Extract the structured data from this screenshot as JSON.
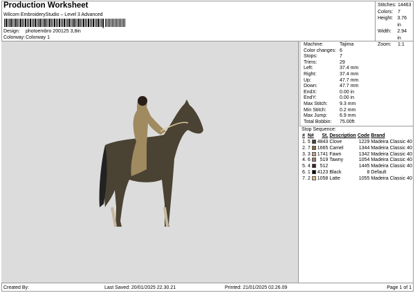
{
  "header": {
    "title": "Production Worksheet",
    "subtitle": "Wilcom EmbroideryStudio – Level 3 Advanced",
    "barcode_suffix": ",",
    "design_label": "Design:",
    "design_value": "photoembro 200125 3,8in",
    "colorway_label": "Colorway:",
    "colorway_value": "Colorway 1"
  },
  "stats": [
    {
      "k": "Stitches:",
      "v": "14463"
    },
    {
      "k": "Colors:",
      "v": "7"
    },
    {
      "k": "Height:",
      "v": "3.76 in"
    },
    {
      "k": "Width:",
      "v": "2.94 in"
    },
    {
      "k": "Zoom:",
      "v": "1:1"
    }
  ],
  "machine_info": [
    {
      "k": "Machine:",
      "v": "Tajima"
    },
    {
      "k": "Color changes:",
      "v": "6"
    },
    {
      "k": "Stops:",
      "v": "7"
    },
    {
      "k": "Trims:",
      "v": "29"
    },
    {
      "k": "Left:",
      "v": "37.4 mm"
    },
    {
      "k": "Right:",
      "v": "37.4 mm"
    },
    {
      "k": "Up:",
      "v": "47.7 mm"
    },
    {
      "k": "Down:",
      "v": "47.7 mm"
    },
    {
      "k": "EndX:",
      "v": "0.00 in"
    },
    {
      "k": "EndY:",
      "v": "0.00 in"
    },
    {
      "k": "Max Stitch:",
      "v": "9.3 mm"
    },
    {
      "k": "Min Stitch:",
      "v": "0.2 mm"
    },
    {
      "k": "Max Jump:",
      "v": "6.9 mm"
    },
    {
      "k": "Total Bobbin:",
      "v": "75.00ft"
    }
  ],
  "stop_sequence": {
    "title": "Stop Sequence:",
    "headers": [
      "#",
      "N#",
      "St.",
      "Description",
      "Code",
      "Brand"
    ],
    "rows": [
      {
        "n": "1.",
        "nn": "5",
        "color": "#4b3d30",
        "st": "4843",
        "desc": "Clove",
        "code": "1229",
        "brand": "Madeira Classic 40"
      },
      {
        "n": "2.",
        "nn": "7",
        "color": "#8b6a3e",
        "st": "1665",
        "desc": "Camel",
        "code": "1344",
        "brand": "Madeira Classic 40"
      },
      {
        "n": "3.",
        "nn": "3",
        "color": "#c9a08a",
        "st": "1741",
        "desc": "Fawn",
        "code": "1342",
        "brand": "Madeira Classic 40"
      },
      {
        "n": "4.",
        "nn": "6",
        "color": "#9d7d70",
        "st": "519",
        "desc": "Tawny",
        "code": "1054",
        "brand": "Madeira Classic 40"
      },
      {
        "n": "5.",
        "nn": "4",
        "color": "#3c2229",
        "st": "512",
        "desc": "",
        "code": "1445",
        "brand": "Madeira Classic 40"
      },
      {
        "n": "6.",
        "nn": "1",
        "color": "#000000",
        "st": "4123",
        "desc": "Black",
        "code": "8",
        "brand": "Default"
      },
      {
        "n": "7.",
        "nn": "2",
        "color": "#d9b98c",
        "st": "1058",
        "desc": "Latte",
        "code": "1055",
        "brand": "Madeira Classic 40"
      }
    ]
  },
  "footer": {
    "created_by": "Created By:",
    "last_saved": "Last Saved: 20/01/2025 22.30.21",
    "printed": "Printed: 21/01/2025 02.26.09",
    "page": "Page 1 of 1"
  }
}
